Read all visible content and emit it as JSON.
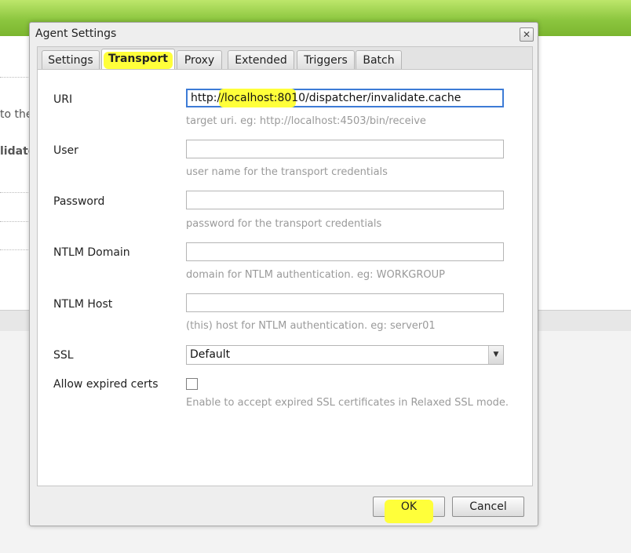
{
  "background": {
    "text_1": "to the",
    "text_2": "lidate"
  },
  "dialog": {
    "title": "Agent Settings",
    "close_icon": "close-icon"
  },
  "tabs": [
    {
      "label": "Settings"
    },
    {
      "label": "Transport",
      "active": true
    },
    {
      "label": "Proxy"
    },
    {
      "label": "Extended"
    },
    {
      "label": "Triggers"
    },
    {
      "label": "Batch"
    }
  ],
  "form": {
    "uri": {
      "label": "URI",
      "value": "http://localhost:8010/dispatcher/invalidate.cache",
      "hint": "target uri. eg: http://localhost:4503/bin/receive"
    },
    "user": {
      "label": "User",
      "value": "",
      "hint": "user name for the transport credentials"
    },
    "password": {
      "label": "Password",
      "value": "",
      "hint": "password for the transport credentials"
    },
    "ntlm_domain": {
      "label": "NTLM Domain",
      "value": "",
      "hint": "domain for NTLM authentication. eg: WORKGROUP"
    },
    "ntlm_host": {
      "label": "NTLM Host",
      "value": "",
      "hint": "(this) host for NTLM authentication. eg: server01"
    },
    "ssl": {
      "label": "SSL",
      "value": "Default",
      "arrow_icon": "chevron-down-icon"
    },
    "allow_expired": {
      "label": "Allow expired certs",
      "checked": false,
      "hint": "Enable to accept expired SSL certificates in Relaxed SSL mode."
    }
  },
  "buttons": {
    "ok": "OK",
    "cancel": "Cancel"
  },
  "colors": {
    "topbar": "#8cc63f",
    "highlight": "#ffff3a",
    "focus": "#3d7bd6"
  }
}
